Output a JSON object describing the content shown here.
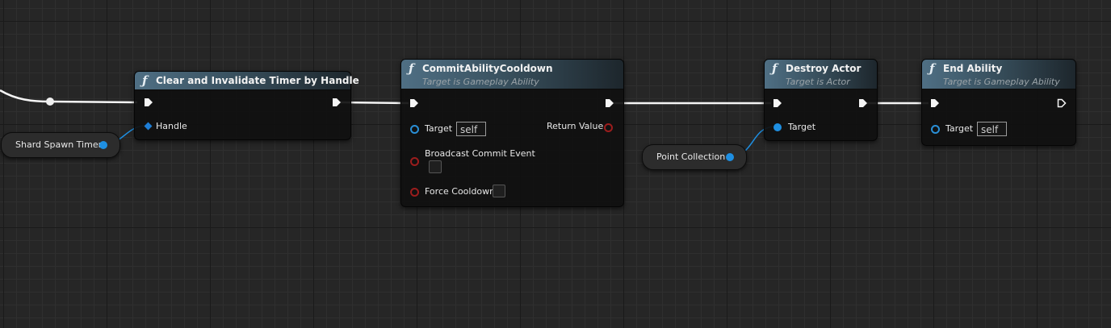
{
  "nodes": {
    "clear_timer": {
      "title": "Clear and Invalidate Timer by Handle",
      "pins": {
        "handle": "Handle"
      }
    },
    "commit_cooldown": {
      "title": "CommitAbilityCooldown",
      "subtitle": "Target is Gameplay Ability",
      "pins": {
        "target": "Target",
        "target_value": "self",
        "return_value": "Return Value",
        "broadcast_commit_event": "Broadcast Commit Event",
        "force_cooldown": "Force Cooldown"
      }
    },
    "destroy_actor": {
      "title": "Destroy Actor",
      "subtitle": "Target is Actor",
      "pins": {
        "target": "Target"
      }
    },
    "end_ability": {
      "title": "End Ability",
      "subtitle": "Target is Gameplay Ability",
      "pins": {
        "target": "Target",
        "target_value": "self"
      }
    }
  },
  "variables": {
    "shard_spawn_timer": "Shard Spawn Timer",
    "point_collection": "Point Collection"
  },
  "icons": {
    "function": "ƒ"
  },
  "colors": {
    "exec_wire": "#ffffff",
    "object_pin": "#1e8fe2",
    "bool_pin": "#9b1d1d",
    "header_accent": "#4f6f84"
  }
}
